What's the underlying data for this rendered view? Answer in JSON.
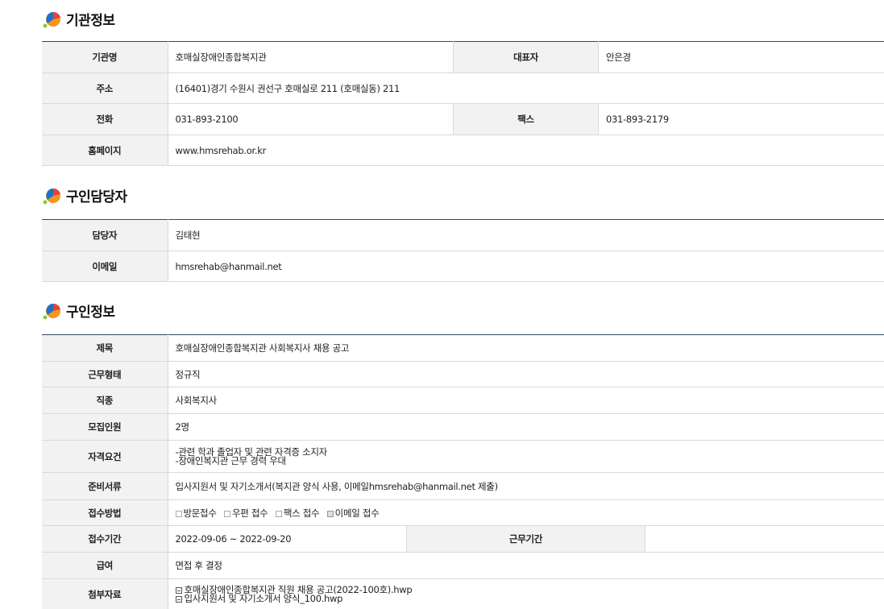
{
  "org": {
    "title": "기관정보",
    "name_label": "기관명",
    "name": "호매실장애인종합복지관",
    "rep_label": "대표자",
    "rep": "안은경",
    "addr_label": "주소",
    "addr": "(16401)경기 수원시 권선구 호매실로 211 (호매실동) 211",
    "phone_label": "전화",
    "phone": "031-893-2100",
    "fax_label": "팩스",
    "fax": "031-893-2179",
    "home_label": "홈페이지",
    "home": "www.hmsrehab.or.kr"
  },
  "contact": {
    "title": "구인담당자",
    "person_label": "담당자",
    "person": "김태현",
    "email_label": "이메일",
    "email": "hmsrehab@hanmail.net"
  },
  "job": {
    "title": "구인정보",
    "subject_label": "제목",
    "subject": "호매실장애인종합복지관 사회복지사 채용 공고",
    "type_label": "근무형태",
    "type": "정규직",
    "kind_label": "직종",
    "kind": "사회복지사",
    "count_label": "모집인원",
    "count": "2명",
    "qual_label": "자격요건",
    "qual_1": "-관련 학과 졸업자 및 관련 자격증 소지자",
    "qual_2": "-장애인복지관 근무 경력 우대",
    "docs_label": "준비서류",
    "docs": "입사지원서 및 자기소개서(복지관 양식 사용, 이메일hmsrehab@hanmail.net 제출)",
    "method_label": "접수방법",
    "methods": [
      "방문접수",
      "우편 접수",
      "팩스 접수",
      "이메일 접수"
    ],
    "methods_checked": [
      false,
      false,
      false,
      true
    ],
    "period_label": "접수기간",
    "period": "2022-09-06 ~ 2022-09-20",
    "work_period_label": "근무기간",
    "work_period": "",
    "salary_label": "급여",
    "salary": "면접 후 결정",
    "files_label": "첨부자료",
    "files": [
      "호매실장애인종합복지관 직원 채용 공고(2022-100호).hwp",
      "입사지원서 및 자기소개서 양식_100.hwp"
    ]
  },
  "colors": {
    "accent_orange": "#f7941d",
    "accent_blue": "#1a73c9",
    "accent_red": "#e8413c",
    "accent_green": "#8dc63f",
    "table_border_top": "#2c4a6b"
  }
}
